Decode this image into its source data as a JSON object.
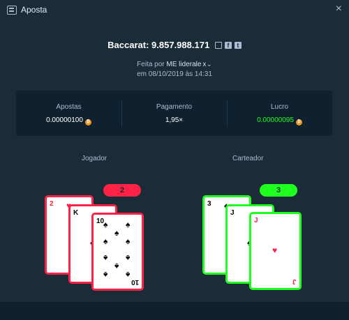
{
  "window": {
    "title": "Aposta",
    "close_glyph": "×"
  },
  "headline": {
    "text": "Baccarat: 9.857.988.171"
  },
  "meta": {
    "prefix": "Feita por",
    "user": "ME liderale x",
    "caret": "⌄",
    "date": "em 08/10/2019 às 14:31"
  },
  "stats": {
    "bet": {
      "label": "Apostas",
      "value": "0.00000100"
    },
    "payout": {
      "label": "Pagamento",
      "value": "1,95×"
    },
    "profit": {
      "label": "Lucro",
      "value": "0.00000095"
    }
  },
  "player": {
    "label": "Jogador",
    "score": "2",
    "cards": [
      {
        "rank": "2",
        "suit": "hearts"
      },
      {
        "rank": "K",
        "suit": "spades"
      },
      {
        "rank": "10",
        "suit": "spades"
      }
    ]
  },
  "banker": {
    "label": "Carteador",
    "score": "3",
    "cards": [
      {
        "rank": "3",
        "suit": "spades"
      },
      {
        "rank": "J",
        "suit": "spades"
      },
      {
        "rank": "J",
        "suit": "hearts"
      }
    ]
  },
  "colors": {
    "background": "#1a2c38",
    "panel": "#0f212e",
    "lose": "#fe2247",
    "win": "#1fff20",
    "muted": "#b1bad3"
  },
  "icons": {
    "title": "list-icon",
    "copy": "copy-icon",
    "facebook": "facebook-icon",
    "twitter": "twitter-icon",
    "coin": "bitcoin-icon"
  }
}
